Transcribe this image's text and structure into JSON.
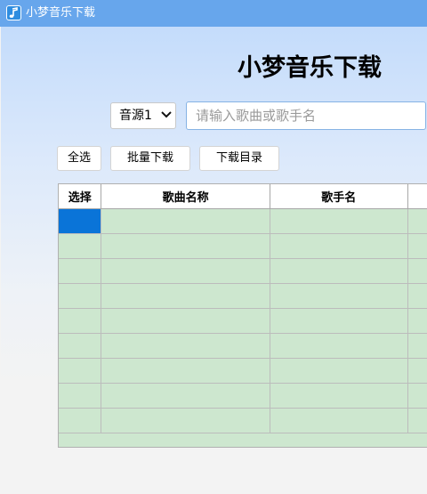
{
  "window": {
    "title": "小梦音乐下载",
    "icon": "music-note-icon"
  },
  "main": {
    "heading": "小梦音乐下载",
    "source_select": {
      "value": "音源1"
    },
    "search": {
      "placeholder": "请输入歌曲或歌手名",
      "value": ""
    },
    "buttons": {
      "select_all": "全选",
      "batch_download": "批量下载",
      "download_dir": "下载目录"
    },
    "table": {
      "headers": [
        "选择",
        "歌曲名称",
        "歌手名",
        ""
      ],
      "row_count": 9,
      "selected_row": 0
    }
  },
  "colors": {
    "titlebar": "#67a6ec",
    "grid_bg": "#cde7cf",
    "selection": "#0a74d8"
  }
}
